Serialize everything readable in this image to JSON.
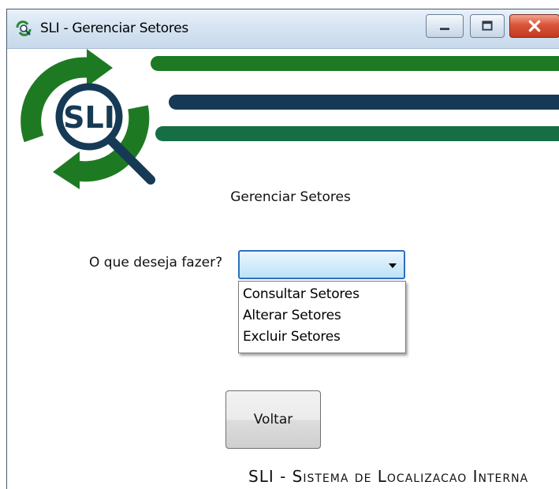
{
  "window": {
    "title": "SLI - Gerenciar Setores"
  },
  "logo": {
    "text": "SLI"
  },
  "main": {
    "heading": "Gerenciar Setores",
    "question_label": "O que deseja fazer?",
    "combo": {
      "value": "",
      "options": [
        "Consultar Setores",
        "Alterar Setores",
        "Excluir Setores"
      ]
    },
    "back_button_label": "Voltar",
    "footer": "SLI - Sistema de Localizacao Interna"
  },
  "colors": {
    "title_bar": "#d6e4f2",
    "close_button": "#c23a1e",
    "logo_green": "#1e7a22",
    "logo_navy": "#163a55",
    "logo_teal": "#166f44",
    "combo_border": "#2f6fbf"
  },
  "icons": {
    "app": "sli-app-icon",
    "minimize": "minimize-icon",
    "maximize": "maximize-icon",
    "close": "close-icon",
    "dropdown": "chevron-down-icon"
  }
}
